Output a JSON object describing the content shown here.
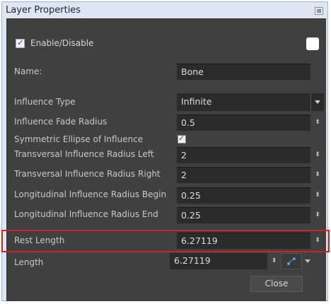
{
  "window": {
    "title": "Layer Properties",
    "close_glyph": "⊠"
  },
  "enable": {
    "checked": true,
    "label": "Enable/Disable",
    "color_swatch": "#ffffff"
  },
  "name": {
    "label": "Name:",
    "value": "Bone"
  },
  "influence_type": {
    "label": "Influence Type",
    "value": "Infinite"
  },
  "fade_radius": {
    "label": "Influence Fade Radius",
    "value": "0.5"
  },
  "symmetric": {
    "label": "Symmetric Ellipse of Influence",
    "checked": true
  },
  "trans_left": {
    "label": "Transversal Influence Radius Left",
    "value": "2"
  },
  "trans_right": {
    "label": "Transversal Influence Radius Right",
    "value": "2"
  },
  "long_begin": {
    "label": "Longitudinal Influence Radius Begin",
    "value": "0.25"
  },
  "long_end": {
    "label": "Longitudinal Influence Radius End",
    "value": "0.25"
  },
  "rest_length": {
    "label": "Rest Length",
    "value": "6.27119"
  },
  "length": {
    "label": "Length",
    "value": "6.27119"
  },
  "spin_glyph": "⬍",
  "check_glyph": "✓",
  "close_button": "Close",
  "colors": {
    "highlight": "#cc2222",
    "panel": "#404040",
    "field": "#2b2b2b"
  }
}
